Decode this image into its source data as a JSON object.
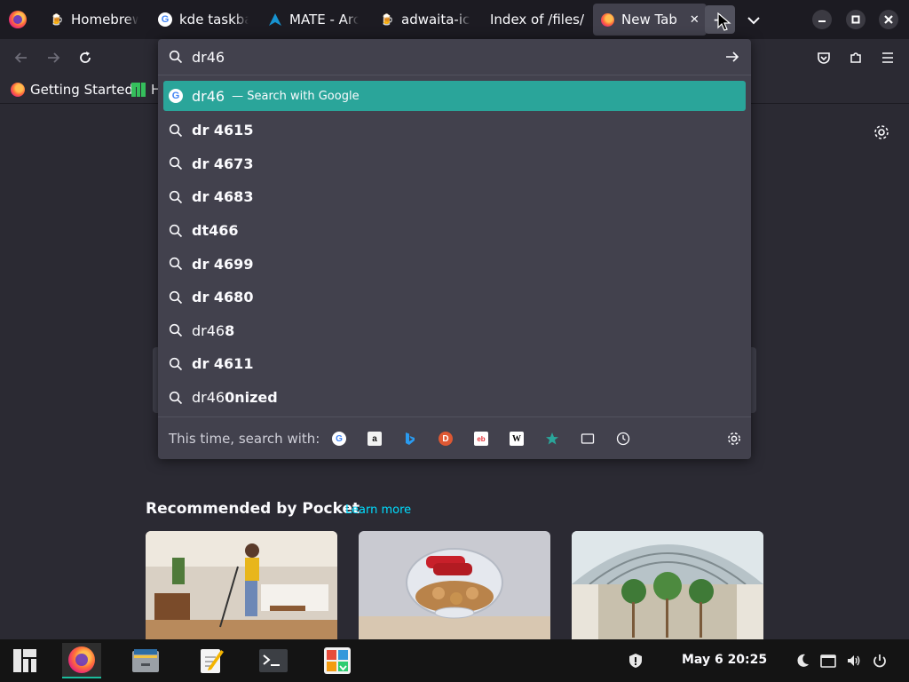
{
  "tabs": [
    {
      "title": "Homebrew",
      "icon": "beer-mug-icon"
    },
    {
      "title": "kde taskbar",
      "icon": "google-g-icon"
    },
    {
      "title": "MATE - Arch",
      "icon": "arch-linux-icon"
    },
    {
      "title": "adwaita-icon",
      "icon": "beer-mug-icon"
    },
    {
      "title": "Index of /files/",
      "icon": ""
    },
    {
      "title": "New Tab",
      "icon": "firefox-icon",
      "close": "✕"
    }
  ],
  "new_tab_button": "+",
  "bookmarks": [
    {
      "label": "Getting Started",
      "icon": "firefox-icon"
    },
    {
      "label": "H",
      "icon": "manjaro-icon"
    }
  ],
  "urlbar": {
    "value": "dr46",
    "results": [
      {
        "typed": "dr46",
        "suffix": "",
        "action": "— Search with Google",
        "selected": true
      },
      {
        "typed": "",
        "suffix": "dr 4615"
      },
      {
        "typed": "",
        "suffix": "dr 4673"
      },
      {
        "typed": "",
        "suffix": "dr 4683"
      },
      {
        "typed": "",
        "suffix": "dt466"
      },
      {
        "typed": "",
        "suffix": "dr 4699"
      },
      {
        "typed": "",
        "suffix": "dr 4680"
      },
      {
        "typed": "dr46",
        "suffix": "8"
      },
      {
        "typed": "",
        "suffix": "dr 4611"
      },
      {
        "typed": "dr46",
        "suffix": "0nized"
      }
    ],
    "oneoff_label": "This time, search with:",
    "engines": [
      "google",
      "amazon",
      "bing",
      "duckduckgo",
      "ebay",
      "wikipedia",
      "bookmarks",
      "tabs",
      "history"
    ]
  },
  "pocket": {
    "title": "Recommended by Pocket",
    "learn_more": "Learn more"
  },
  "taskbar": {
    "clock": "May 6  20:25"
  },
  "colors": {
    "accent": "#2aa59a",
    "panel": "#42414d",
    "background": "#2b2a33",
    "link": "#00ddff"
  }
}
